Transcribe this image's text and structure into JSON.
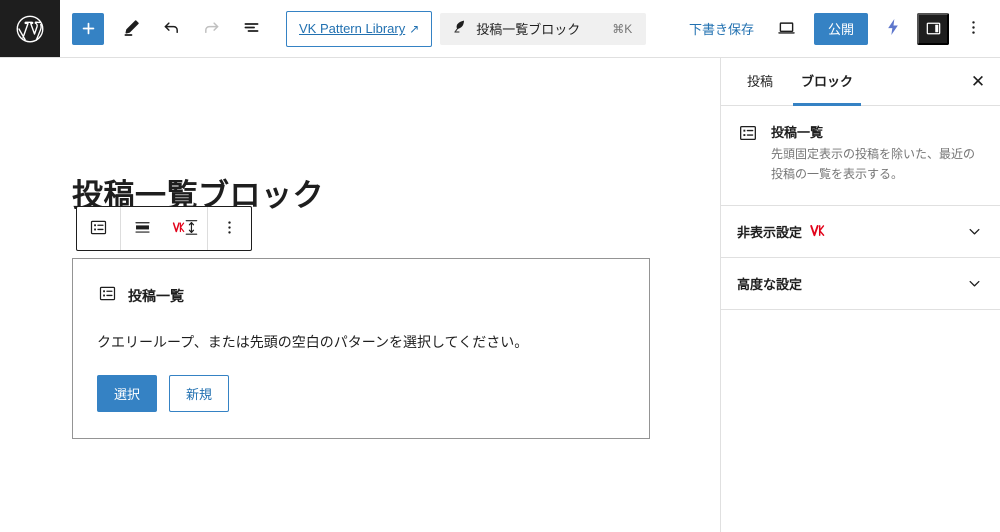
{
  "app": {
    "name": "WordPress Block Editor",
    "accent_blue": "#3582c4",
    "link_blue": "#2271b1",
    "dark": "#1e1e1e",
    "bolt_purple": "#5e77cc",
    "vk_red": "#e2041b"
  },
  "topbar": {
    "wp_logo_name": "wordpress-logo",
    "add_block_label": "+",
    "tools": [
      {
        "name": "edit-tool-icon",
        "label": "ツール",
        "disabled": false
      },
      {
        "name": "undo-icon",
        "label": "元に戻す",
        "disabled": false
      },
      {
        "name": "redo-icon",
        "label": "やり直し",
        "disabled": true
      },
      {
        "name": "document-overview-icon",
        "label": "ドキュメント概観",
        "disabled": false
      }
    ],
    "pattern_library": {
      "label": "VK Pattern Library",
      "external_icon": "↗"
    },
    "command_palette": {
      "icon": "feather-pen-icon",
      "text": "投稿一覧ブロック",
      "shortcut": "⌘K"
    },
    "save_draft_label": "下書き保存",
    "preview_icon_name": "preview-desktop-icon",
    "publish_label": "公開",
    "bolt_icon_name": "jetpack-bolt-icon",
    "sidebar_toggle_name": "settings-sidebar-toggle",
    "options_menu_name": "options-ellipsis-icon"
  },
  "editor": {
    "post_title": "投稿一覧ブロック",
    "block_toolbar": [
      {
        "name": "block-type-post-list-icon",
        "label": "投稿一覧"
      },
      {
        "name": "block-align-icon",
        "label": "配置"
      },
      {
        "name": "vk-margin-icon",
        "label": "余白設定"
      },
      {
        "name": "block-options-ellipsis-icon",
        "label": "オプション"
      }
    ],
    "placeholder": {
      "icon_name": "post-list-icon",
      "title": "投稿一覧",
      "instructions": "クエリーループ、または先頭の空白のパターンを選択してください。",
      "choose_label": "選択",
      "new_label": "新規"
    }
  },
  "sidebar": {
    "tabs": [
      {
        "label": "投稿",
        "active": false
      },
      {
        "label": "ブロック",
        "active": true
      }
    ],
    "close_label": "✕",
    "block_card": {
      "icon_name": "post-list-icon",
      "title": "投稿一覧",
      "description": "先頭固定表示の投稿を除いた、最近の投稿の一覧を表示する。"
    },
    "panels": [
      {
        "title": "非表示設定",
        "has_vk_logo": true,
        "expanded": false,
        "chevron": "chevron-down-icon"
      },
      {
        "title": "高度な設定",
        "has_vk_logo": false,
        "expanded": false,
        "chevron": "chevron-down-icon"
      }
    ]
  }
}
